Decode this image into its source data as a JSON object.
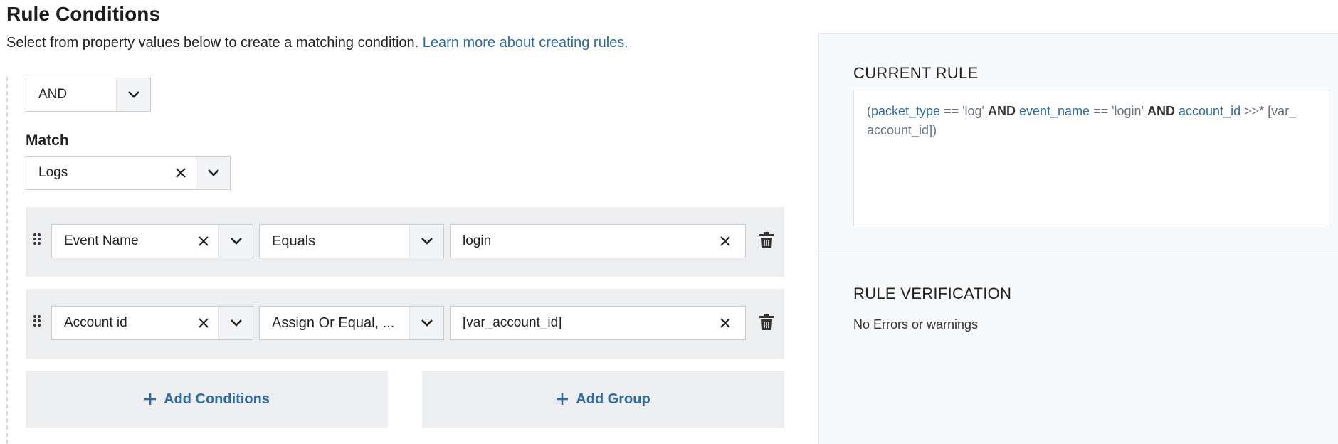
{
  "header": {
    "title": "Rule Conditions",
    "subtitle": "Select from property values below to create a matching condition.",
    "learn_more": "Learn more about creating rules."
  },
  "logic": {
    "operator": "AND"
  },
  "match": {
    "label": "Match",
    "value": "Logs"
  },
  "conditions": [
    {
      "field": "Event Name",
      "operator": "Equals",
      "value": "login"
    },
    {
      "field": "Account id",
      "operator": "Assign Or Equal, ...",
      "value": "[var_account_id]"
    }
  ],
  "actions": {
    "add_conditions": "Add Conditions",
    "add_group": "Add Group"
  },
  "current_rule": {
    "heading": "CURRENT RULE",
    "parts": {
      "open": "(",
      "k1": "packet_type",
      "t1": " == 'log' ",
      "and1": "AND",
      "k2": " event_name",
      "t2": " == 'login' ",
      "and2": "AND",
      "k3": " account_id",
      "t3": " >>* [var_",
      "t4": "account_id])"
    }
  },
  "verification": {
    "heading": "RULE VERIFICATION",
    "message": "No Errors or warnings"
  },
  "colors": {
    "link": "#2c6ba8",
    "row_bg": "#edeef0",
    "panel_bg": "#f8f9fa"
  }
}
